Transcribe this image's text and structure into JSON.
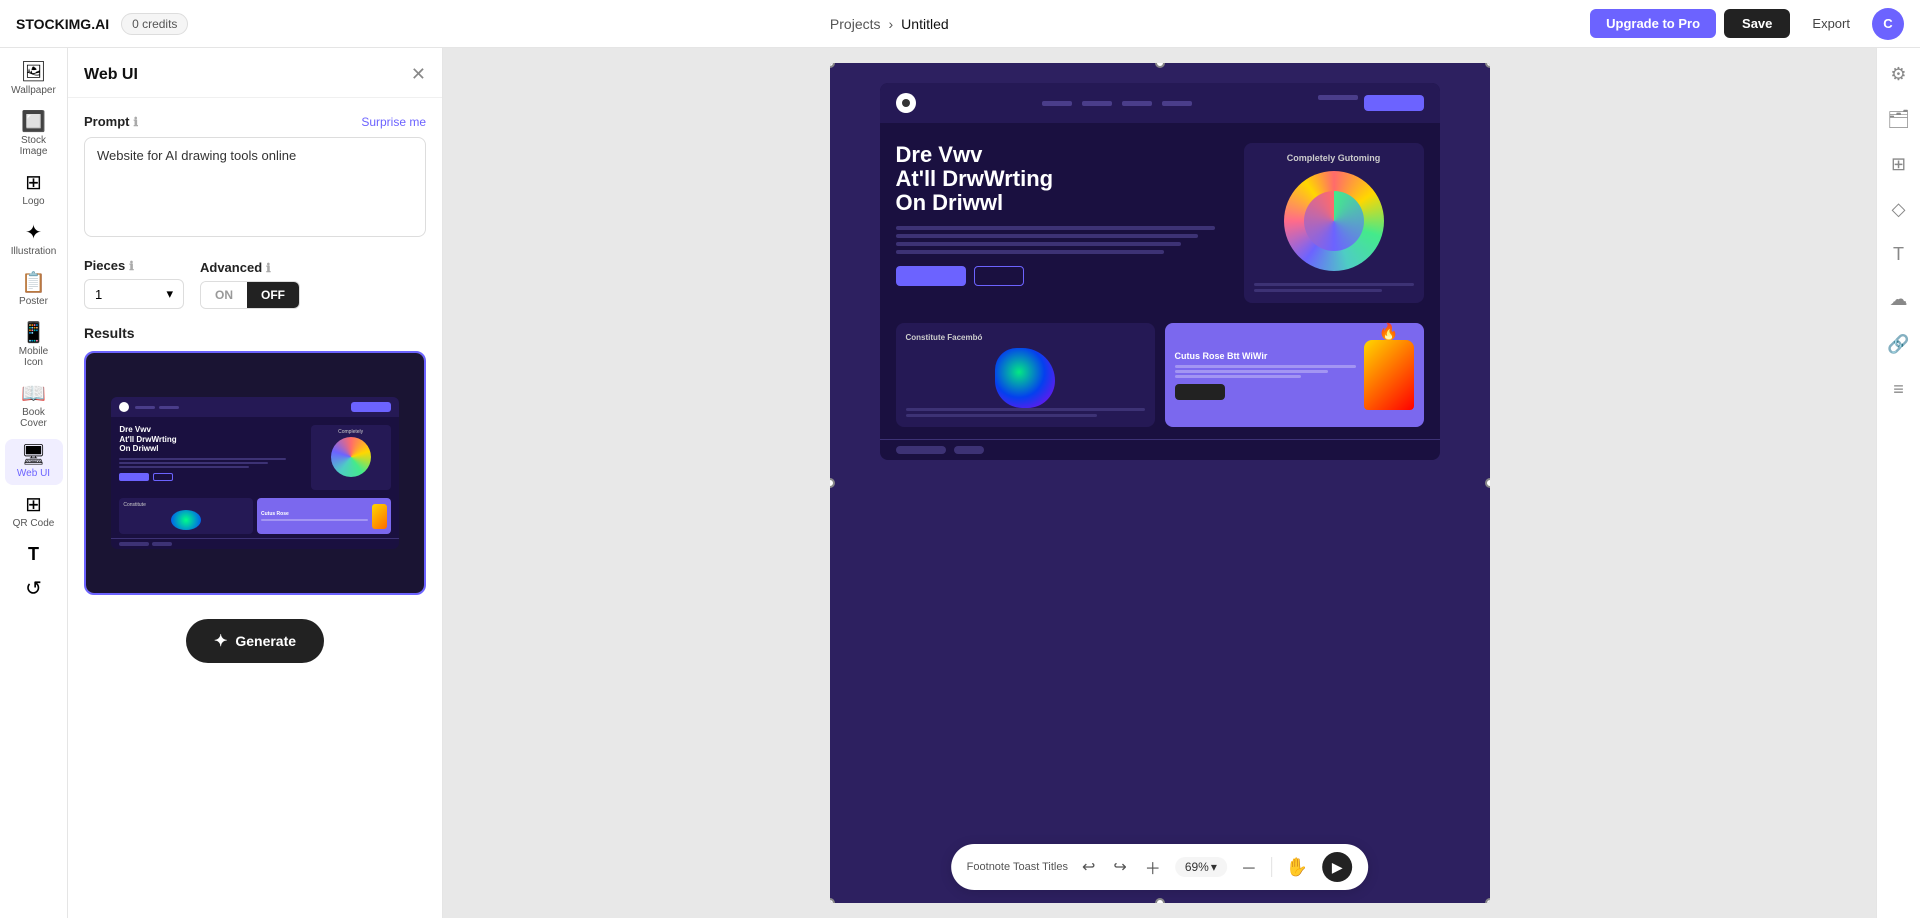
{
  "topbar": {
    "logo": "STOCKIMG.AI",
    "credits": "0 credits",
    "nav_projects": "Projects",
    "nav_separator": "›",
    "nav_current": "Untitled",
    "btn_upgrade": "Upgrade to Pro",
    "btn_save": "Save",
    "btn_export": "Export",
    "avatar_initials": "C"
  },
  "icon_sidebar": {
    "items": [
      {
        "id": "wallpaper",
        "icon": "🖼",
        "label": "Wallpaper"
      },
      {
        "id": "stock-image",
        "icon": "🔲",
        "label": "Stock Image"
      },
      {
        "id": "logo",
        "icon": "⊞",
        "label": "Logo"
      },
      {
        "id": "illustration",
        "icon": "✦",
        "label": "Illustration"
      },
      {
        "id": "poster",
        "icon": "📋",
        "label": "Poster"
      },
      {
        "id": "mobile-icon",
        "icon": "📱",
        "label": "Mobile Icon"
      },
      {
        "id": "book-cover",
        "icon": "📖",
        "label": "Book Cover"
      },
      {
        "id": "web-ui",
        "icon": "🖥",
        "label": "Web UI",
        "active": true
      },
      {
        "id": "qr-code",
        "icon": "⊞",
        "label": "QR Code"
      },
      {
        "id": "text",
        "icon": "T",
        "label": ""
      },
      {
        "id": "history",
        "icon": "↺",
        "label": ""
      }
    ]
  },
  "panel": {
    "title": "Web UI",
    "prompt_label": "Prompt",
    "surprise_label": "Surprise me",
    "prompt_value": "Website for AI drawing tools online",
    "prompt_placeholder": "Website for AI drawing tools online",
    "pieces_label": "Pieces",
    "advanced_label": "Advanced",
    "pieces_value": "1",
    "toggle_on": "ON",
    "toggle_off": "OFF",
    "results_label": "Results",
    "generate_label": "Generate"
  },
  "canvas": {
    "zoom_level": "69%",
    "bottom_label": "Footnote Toast Titles"
  },
  "web_preview": {
    "hero_title_line1": "Dre Vwv",
    "hero_title_line2": "At'll DrwWrting",
    "hero_title_line3": "On Driwwl",
    "card_title": "Completely Gutoming",
    "section2_title": "Constitute Facembó",
    "section3_title": "Cutus Rose Btt WiWir"
  }
}
